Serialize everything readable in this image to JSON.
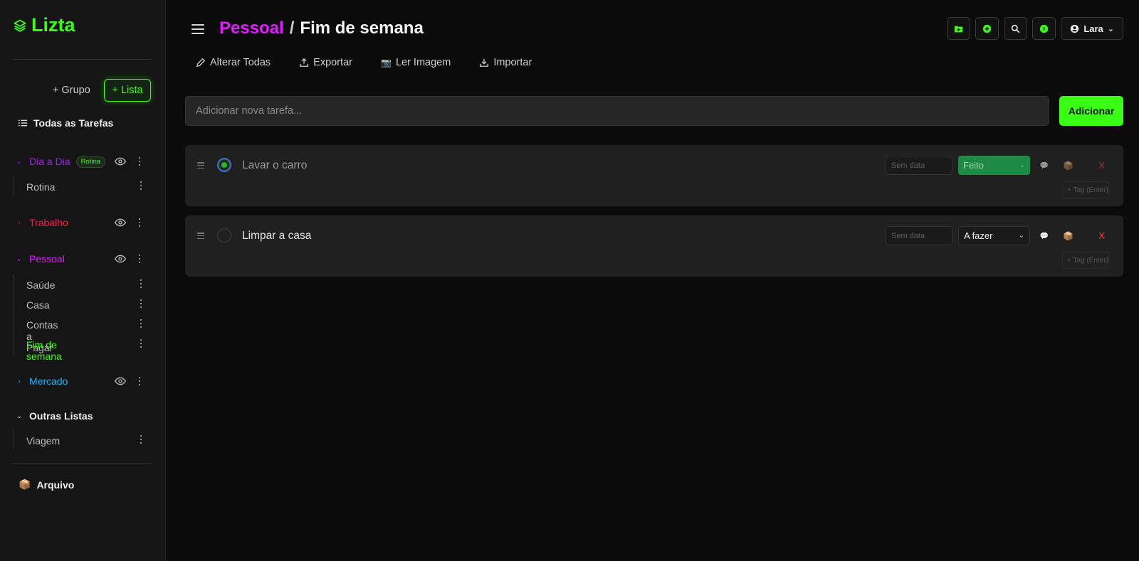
{
  "app": {
    "name": "Lizta",
    "accent": "#39ff14"
  },
  "sidebar": {
    "group_button": "+ Grupo",
    "list_button": "+ Lista",
    "all_tasks": "Todas as Tarefas",
    "groups": [
      {
        "name": "Dia a Dia",
        "color": "#a020f0",
        "expanded": true,
        "badge": "Rotina",
        "lists": [
          "Rotina"
        ]
      },
      {
        "name": "Trabalho",
        "color": "#ff1a4a",
        "expanded": false,
        "lists": []
      },
      {
        "name": "Pessoal",
        "color": "#e11cff",
        "expanded": true,
        "lists": [
          "Saúde",
          "Casa",
          "Contas a Pagar",
          "Fim de semana"
        ],
        "active_list": "Fim de semana"
      },
      {
        "name": "Mercado",
        "color": "#1fb3ff",
        "expanded": false,
        "lists": []
      }
    ],
    "other": {
      "name": "Outras Listas",
      "lists": [
        "Viagem"
      ]
    },
    "archive": "Arquivo"
  },
  "header": {
    "group": "Pessoal",
    "separator": "/",
    "list": "Fim de semana",
    "user": "Lara"
  },
  "toolbar": {
    "edit_all": "Alterar Todas",
    "export": "Exportar",
    "read_image": "Ler Imagem",
    "import": "Importar"
  },
  "add_task": {
    "placeholder": "Adicionar nova tarefa...",
    "button": "Adicionar"
  },
  "tasks": [
    {
      "title": "Lavar o carro",
      "date_placeholder": "Sem data",
      "status": "Feito",
      "done": true,
      "tag_placeholder": "+ Tag (Enter)"
    },
    {
      "title": "Limpar a casa",
      "date_placeholder": "Sem data",
      "status": "A fazer",
      "done": false,
      "tag_placeholder": "+ Tag (Enter)"
    }
  ]
}
